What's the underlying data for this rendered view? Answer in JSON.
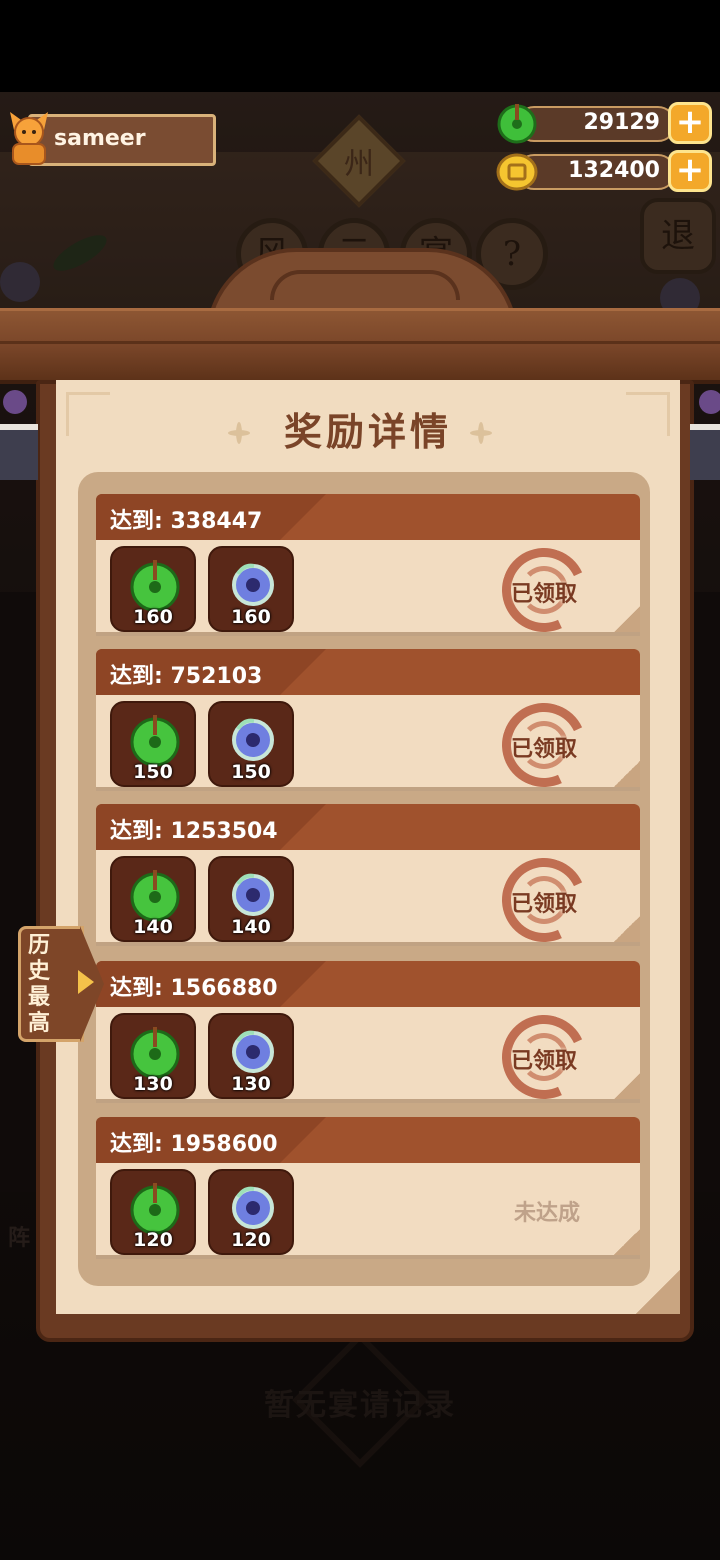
{
  "player": {
    "name": "sameer"
  },
  "currencies": [
    {
      "name": "jade",
      "value": "29129",
      "icon": "green-jade-icon"
    },
    {
      "name": "coin",
      "value": "132400",
      "icon": "gold-coin-icon"
    }
  ],
  "background": {
    "sign": "州",
    "buttons": [
      "风",
      "云",
      "宴",
      "?"
    ],
    "exit": "退",
    "empty_text": "暂无宴请记录",
    "side_text": "阵"
  },
  "modal": {
    "title": "奖励详情",
    "rows": [
      {
        "label": "达到: 338447",
        "jade": "160",
        "gem": "160",
        "status": "已领取",
        "claimed": true
      },
      {
        "label": "达到: 752103",
        "jade": "150",
        "gem": "150",
        "status": "已领取",
        "claimed": true
      },
      {
        "label": "达到: 1253504",
        "jade": "140",
        "gem": "140",
        "status": "已领取",
        "claimed": true
      },
      {
        "label": "达到: 1566880",
        "jade": "130",
        "gem": "130",
        "status": "已领取",
        "claimed": true
      },
      {
        "label": "达到: 1958600",
        "jade": "120",
        "gem": "120",
        "status": "未达成",
        "claimed": false
      }
    ]
  },
  "side_tab": {
    "label": "历史最高"
  },
  "colors": {
    "header_brown": "#a0522d",
    "paper": "#f2dcc1",
    "stamp_red": "#b85b3e",
    "plus_orange": "#f3a82a"
  }
}
